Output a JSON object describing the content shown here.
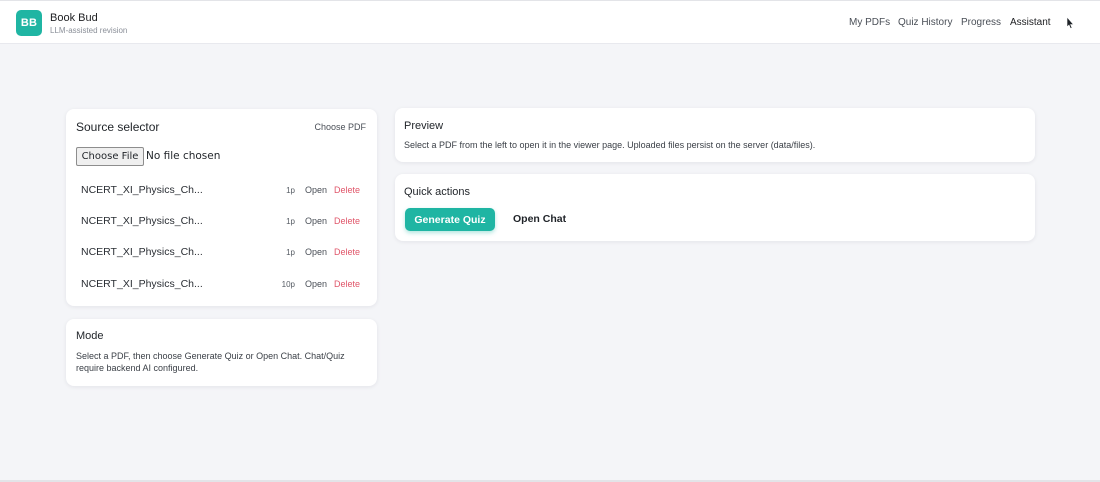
{
  "app": {
    "logo_text": "BB",
    "title": "Book Bud",
    "subtitle": "LLM-assisted revision",
    "accent_color": "#1fb5a3"
  },
  "nav": {
    "items": [
      {
        "label": "My PDFs"
      },
      {
        "label": "Quiz History"
      },
      {
        "label": "Progress"
      },
      {
        "label": "Assistant"
      }
    ],
    "user_icon": "cursor-pointer-icon"
  },
  "source": {
    "title": "Source selector",
    "choose_pdf_label": "Choose PDF",
    "file_button_label": "Choose File",
    "file_status": "No file chosen",
    "files": [
      {
        "name": "NCERT_XI_Physics_Ch...",
        "pages": "1p",
        "open_label": "Open",
        "delete_label": "Delete"
      },
      {
        "name": "NCERT_XI_Physics_Ch...",
        "pages": "1p",
        "open_label": "Open",
        "delete_label": "Delete"
      },
      {
        "name": "NCERT_XI_Physics_Ch...",
        "pages": "1p",
        "open_label": "Open",
        "delete_label": "Delete"
      },
      {
        "name": "NCERT_XI_Physics_Ch...",
        "pages": "10p",
        "open_label": "Open",
        "delete_label": "Delete"
      }
    ]
  },
  "mode": {
    "title": "Mode",
    "text": "Select a PDF, then choose Generate Quiz or Open Chat. Chat/Quiz require backend AI configured."
  },
  "preview": {
    "title": "Preview",
    "text": "Select a PDF from the left to open it in the viewer page. Uploaded files persist on the server (data/files)."
  },
  "actions": {
    "title": "Quick actions",
    "generate_label": "Generate Quiz",
    "chat_label": "Open Chat"
  }
}
